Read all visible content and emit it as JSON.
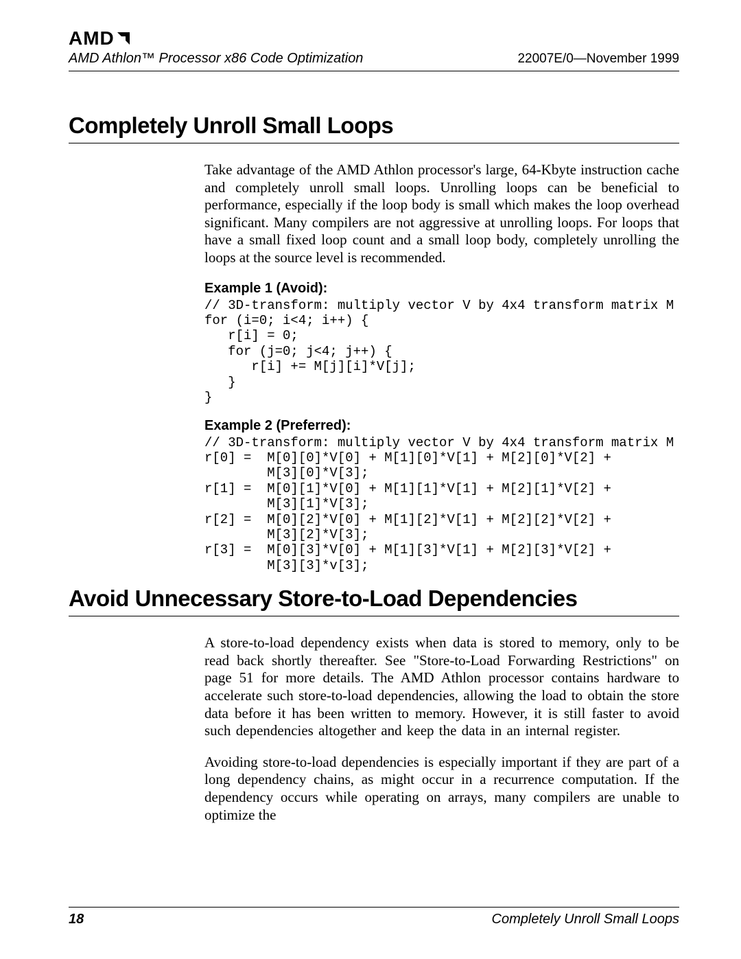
{
  "logo_text": "AMD",
  "header": {
    "doc_title": "AMD Athlon™ Processor x86 Code Optimization",
    "doc_id": "22007E/0—November 1999"
  },
  "section1": {
    "title": "Completely Unroll Small Loops",
    "para": "Take advantage of the AMD Athlon processor's large, 64-Kbyte instruction cache and completely unroll small loops. Unrolling loops can be beneficial to performance, especially if the loop body is small which makes the loop overhead significant. Many compilers are not aggressive at unrolling loops. For loops that have a small fixed loop count and a small loop body, completely unrolling the loops at the source level is recommended.",
    "example1_title": "Example 1 (Avoid):",
    "example1_code": "// 3D-transform: multiply vector V by 4x4 transform matrix M\nfor (i=0; i<4; i++) {\n   r[i] = 0;\n   for (j=0; j<4; j++) {\n      r[i] += M[j][i]*V[j];\n   }\n}",
    "example2_title": "Example 2 (Preferred):",
    "example2_code": "// 3D-transform: multiply vector V by 4x4 transform matrix M\nr[0] =  M[0][0]*V[0] + M[1][0]*V[1] + M[2][0]*V[2] +\n        M[3][0]*V[3];\nr[1] =  M[0][1]*V[0] + M[1][1]*V[1] + M[2][1]*V[2] +\n        M[3][1]*V[3];\nr[2] =  M[0][2]*V[0] + M[1][2]*V[1] + M[2][2]*V[2] +\n        M[3][2]*V[3];\nr[3] =  M[0][3]*V[0] + M[1][3]*V[1] + M[2][3]*V[2] +\n        M[3][3]*v[3];"
  },
  "section2": {
    "title": "Avoid Unnecessary Store-to-Load Dependencies",
    "para1": "A store-to-load dependency exists when data is stored to memory, only to be read back shortly thereafter. See \"Store-to-Load Forwarding Restrictions\" on page 51 for more details. The AMD Athlon processor contains hardware to accelerate such store-to-load dependencies, allowing the load to obtain the store data before it has been written to memory. However, it is still faster to avoid such dependencies altogether and keep the data in an internal register.",
    "para2": "Avoiding store-to-load dependencies is especially important if they are part of a long dependency chains, as might occur in a recurrence computation. If the dependency occurs while operating on arrays, many compilers are unable to optimize the"
  },
  "footer": {
    "page_number": "18",
    "running_title": "Completely Unroll Small Loops"
  }
}
